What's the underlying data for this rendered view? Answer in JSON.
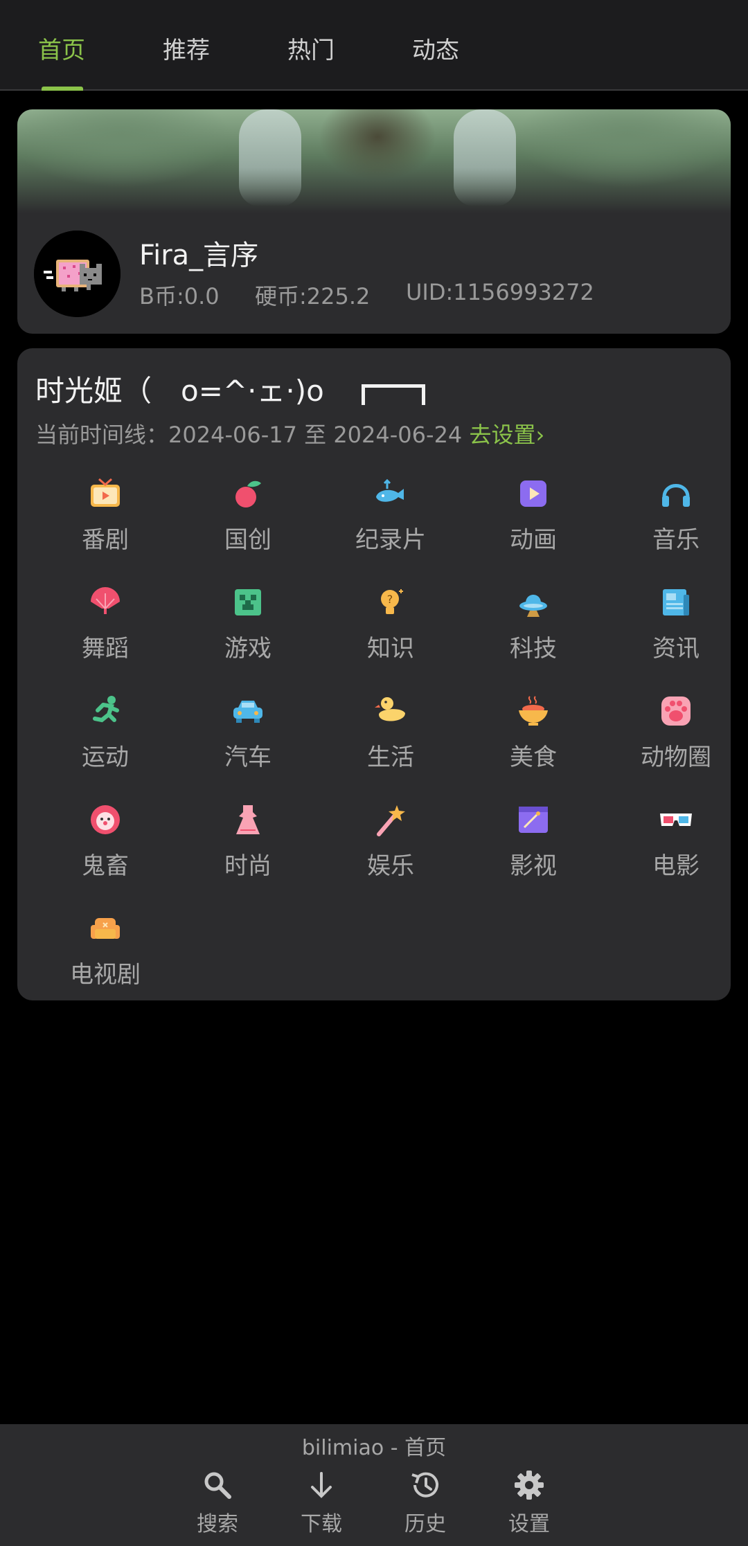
{
  "tabs": [
    {
      "label": "首页",
      "active": true
    },
    {
      "label": "推荐",
      "active": false
    },
    {
      "label": "热门",
      "active": false
    },
    {
      "label": "动态",
      "active": false
    }
  ],
  "profile": {
    "username": "Fira_言序",
    "bcoin": "B币:0.0",
    "coins": "硬币:225.2",
    "uid": "UID:1156993272"
  },
  "main": {
    "title": "时光姬（　o=^·ェ·)o　",
    "timeline_prefix": "当前时间线：2024-06-17 至 2024-06-24 ",
    "timeline_link": "去设置",
    "categories": [
      {
        "label": "番剧",
        "icon": "tv-icon"
      },
      {
        "label": "国创",
        "icon": "peach-icon"
      },
      {
        "label": "纪录片",
        "icon": "whale-icon"
      },
      {
        "label": "动画",
        "icon": "play-box-icon"
      },
      {
        "label": "音乐",
        "icon": "headphones-icon"
      },
      {
        "label": "舞蹈",
        "icon": "fan-icon"
      },
      {
        "label": "游戏",
        "icon": "creeper-icon"
      },
      {
        "label": "知识",
        "icon": "lightbulb-icon"
      },
      {
        "label": "科技",
        "icon": "ufo-icon"
      },
      {
        "label": "资讯",
        "icon": "newspaper-icon"
      },
      {
        "label": "运动",
        "icon": "runner-icon"
      },
      {
        "label": "汽车",
        "icon": "car-icon"
      },
      {
        "label": "生活",
        "icon": "duck-icon"
      },
      {
        "label": "美食",
        "icon": "food-bowl-icon"
      },
      {
        "label": "动物圈",
        "icon": "paw-icon"
      },
      {
        "label": "鬼畜",
        "icon": "clown-icon"
      },
      {
        "label": "时尚",
        "icon": "dress-icon"
      },
      {
        "label": "娱乐",
        "icon": "magic-wand-icon"
      },
      {
        "label": "影视",
        "icon": "film-board-icon"
      },
      {
        "label": "电影",
        "icon": "3d-glasses-icon"
      },
      {
        "label": "电视剧",
        "icon": "sofa-icon"
      }
    ]
  },
  "bottom": {
    "title": "bilimiao - 首页",
    "nav": [
      {
        "label": "搜索",
        "icon": "search-icon"
      },
      {
        "label": "下载",
        "icon": "download-icon"
      },
      {
        "label": "历史",
        "icon": "history-icon"
      },
      {
        "label": "设置",
        "icon": "gear-icon"
      }
    ]
  },
  "colors": {
    "accent": "#8bc34a",
    "background": "#000000",
    "card": "#2c2c2e",
    "topbar": "#1c1c1e"
  }
}
